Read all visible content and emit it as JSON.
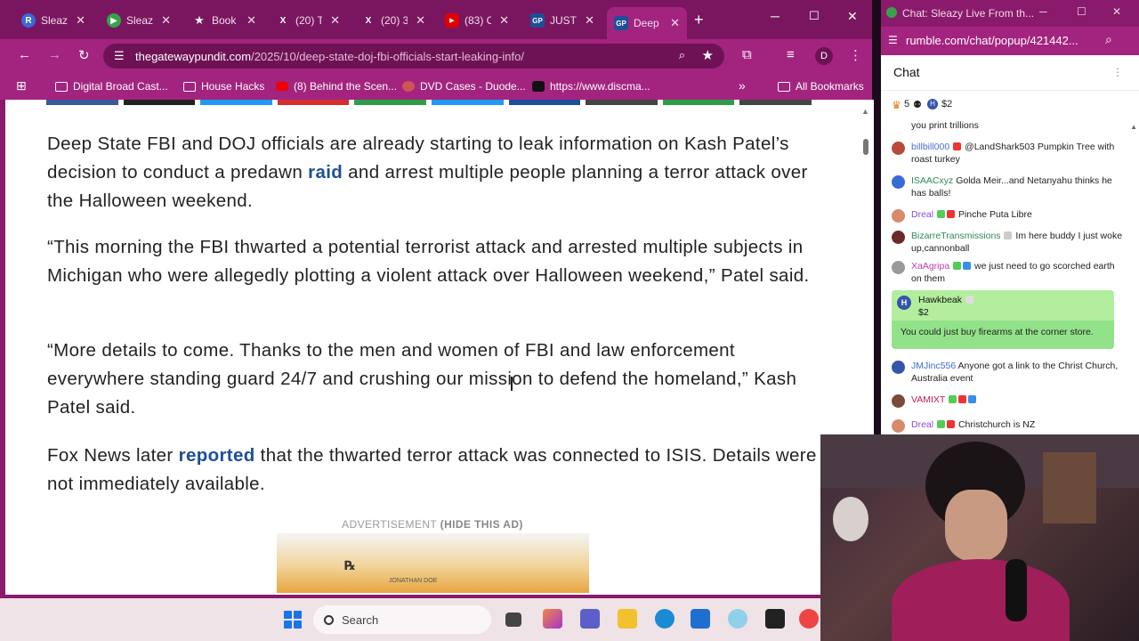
{
  "browser": {
    "tabs": [
      {
        "title": "Sleazy",
        "favicon": "R",
        "favicon_color": "#3a6ad8"
      },
      {
        "title": "Sleazy",
        "favicon": "▶",
        "favicon_color": "#36a34a"
      },
      {
        "title": "Book",
        "favicon": "★",
        "favicon_color": "#a3247f"
      },
      {
        "title": "(20) T",
        "favicon": "X",
        "favicon_color": "#111111"
      },
      {
        "title": "(20) 3",
        "favicon": "X",
        "favicon_color": "#111111"
      },
      {
        "title": "(83) C",
        "favicon": "▶",
        "favicon_color": "#e00000"
      },
      {
        "title": "JUST",
        "favicon": "GP",
        "favicon_color": "#1d4f9a"
      },
      {
        "title": "Deep",
        "favicon": "GP",
        "favicon_color": "#1d4f9a"
      }
    ],
    "url_domain": "thegatewaypundit.com",
    "url_path": "/2025/10/deep-state-doj-fbi-officials-start-leaking-info/",
    "profile_initial": "D",
    "bookmarks": [
      "Digital Broad Cast...",
      "House Hacks",
      "(8) Behind the Scen...",
      "DVD Cases - Duode...",
      "https://www.discma...",
      "All Bookmarks"
    ]
  },
  "article": {
    "p1_before": "Deep State FBI and DOJ officials are already starting to leak information on Kash Patel’s decision to conduct a predawn ",
    "p1_link": "raid",
    "p1_after": " and arrest multiple people planning a terror attack over the Halloween weekend.",
    "p2": "“This morning the FBI thwarted a potential terrorist attack and arrested multiple subjects in Michigan who were allegedly plotting a violent attack over Halloween weekend,” Patel said.",
    "p3": "“More details to come. Thanks to the men and women of FBI and law enforcement everywhere standing guard 24/7 and crushing our mission to defend the homeland,” Kash Patel said.",
    "p4_before": "Fox News later ",
    "p4_link": "reported",
    "p4_after": " that the thwarted terror attack was connected to ISIS. Details were not immediately available.",
    "ad_label": "ADVERTISEMENT",
    "ad_hide": "(HIDE THIS AD)",
    "ad_image_text": "JONATHAN DOE"
  },
  "chat": {
    "window_title": "Chat: Sleazy Live From th...",
    "url": "rumble.com/chat/popup/421442...",
    "header": "Chat",
    "viewers": "5",
    "rant_total": "$2",
    "messages": [
      {
        "user": "",
        "text": "you print trillions",
        "color": "#222222",
        "avatar": "#bbbbbb"
      },
      {
        "user": "billbill000",
        "text": "@LandShark503 Pumpkin Tree with roast turkey",
        "color": "#4a6fd1",
        "avatar": "#b94a3a"
      },
      {
        "user": "ISAACxyz",
        "text": "Golda Meir...and Netanyahu thinks he has balls!",
        "color": "#2e8b57",
        "avatar": "#3a6ad8"
      },
      {
        "user": "Dreal",
        "text": "Pinche Puta Libre",
        "color": "#8a4ad1",
        "avatar": "#d88a6a"
      },
      {
        "user": "BizarreTransmissions",
        "text": "Im here buddy I just woke up,cannonball",
        "color": "#2e8b57",
        "avatar": "#6a2a2a"
      },
      {
        "user": "XaAgripa",
        "text": "we just need to go scorched earth on them",
        "color": "#c23ab0",
        "avatar": "#999999"
      },
      {
        "user": "JMJinc556",
        "text": "Anyone got a link to the Christ Church, Australia event",
        "color": "#3a6ad8",
        "avatar": "#3355aa"
      },
      {
        "user": "VAMIXT",
        "text": "",
        "color": "#c2185b",
        "avatar": "#7a4a3a"
      },
      {
        "user": "Dreal",
        "text": "Christchurch is NZ",
        "color": "#8a4ad1",
        "avatar": "#d88a6a"
      }
    ],
    "rant": {
      "initial": "H",
      "user": "Hawkbeak",
      "amount": "$2",
      "text": "You could just buy firearms at the corner store."
    }
  },
  "taskbar": {
    "search_placeholder": "Search"
  }
}
